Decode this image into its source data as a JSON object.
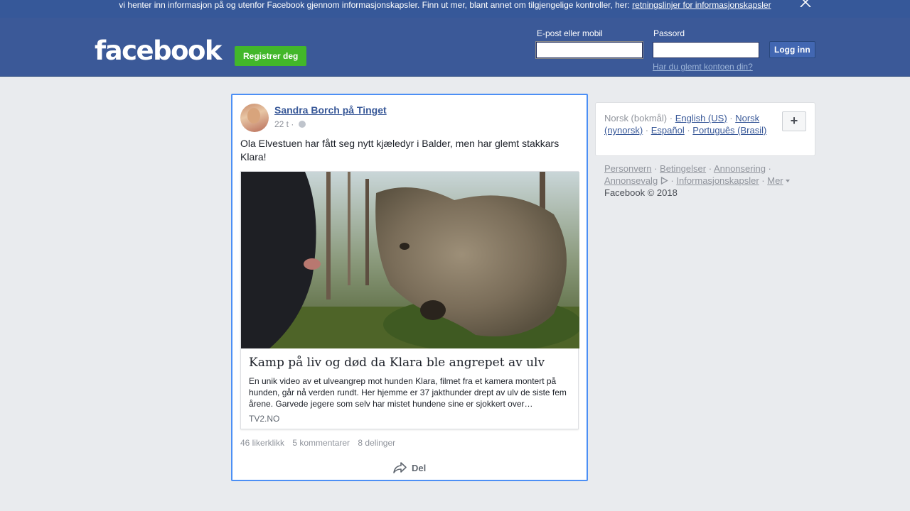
{
  "cookie_banner": {
    "text": "vi henter inn informasjon på og utenfor Facebook gjennom informasjonskapsler. Finn ut mer, blant annet om tilgjengelige kontroller, her:",
    "link": "retningslinjer for informasjonskapsler"
  },
  "header": {
    "logo": "facebook",
    "register_label": "Registrer deg",
    "email_label": "E-post eller mobil",
    "password_label": "Passord",
    "login_label": "Logg inn",
    "forgot_link": "Har du glemt kontoen din?"
  },
  "post": {
    "author": "Sandra Borch på Tinget",
    "time": "22 t ·",
    "text": "Ola Elvestuen har fått seg nytt kjæledyr i Balder, men har glemt stakkars Klara!",
    "link": {
      "title": "Kamp på liv og død da Klara ble angrepet av ulv",
      "description": "En unik video av et ulveangrep mot hunden Klara, filmet fra et kamera montert på hunden, går nå verden rundt. Her hjemme er 37 jakthunder drept av ulv de siste fem årene. Garvede jegere som selv har mistet hundene sine er sjokkert over…",
      "domain": "TV2.NO"
    },
    "stats": {
      "likes": "46 likerklikk",
      "comments": "5 kommentarer",
      "shares": "8 delinger"
    },
    "share_label": "Del"
  },
  "languages": {
    "current": "Norsk (bokmål)",
    "options": [
      "English (US)",
      "Norsk (nynorsk)",
      "Español",
      "Português (Brasil)"
    ],
    "plus_label": "+"
  },
  "footer": {
    "links": [
      "Personvern",
      "Betingelser",
      "Annonsering",
      "Annonsevalg",
      "Informasjonskapsler",
      "Mer"
    ],
    "copyright": "Facebook © 2018"
  }
}
